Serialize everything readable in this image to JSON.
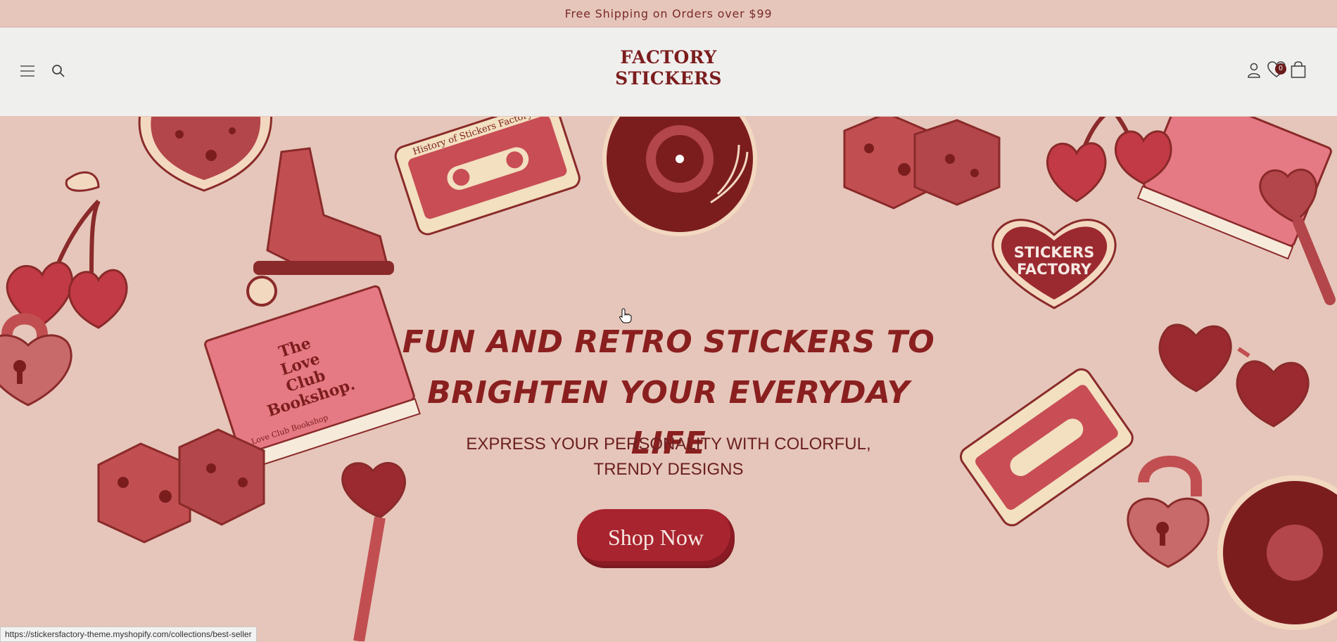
{
  "announcement": {
    "text": "Free Shipping on Orders over $99"
  },
  "header": {
    "logo_line1": "FACTORY",
    "logo_line2": "STICKERS",
    "cart_count": "0",
    "icons": [
      "menu-icon",
      "search-icon",
      "account-icon",
      "wishlist-icon",
      "cart-icon"
    ]
  },
  "hero": {
    "headline_line1": "FUN AND RETRO STICKERS TO",
    "headline_line2": "BRIGHTEN YOUR EVERYDAY LIFE",
    "subtitle_line1": "EXPRESS YOUR PERSONALITY WITH COLORFUL,",
    "subtitle_line2": "TRENDY DESIGNS",
    "cta_label": "Shop Now"
  },
  "stickers": {
    "cassette_label": "History of Stickers Factory",
    "badge_line1": "STICKERS",
    "badge_line2": "FACTORY",
    "book_title_1": "The",
    "book_title_2": "Love",
    "book_title_3": "Club",
    "book_title_4": "Bookshop.",
    "book_spine": "Love Club Bookshop"
  },
  "status_bar": {
    "url": "https://stickersfactory-theme.myshopify.com/collections/best-seller"
  },
  "colors": {
    "background": "#e6c6ba",
    "header_bg": "#efefee",
    "accent": "#a8242f",
    "text_dark_red": "#8a1f1f"
  }
}
